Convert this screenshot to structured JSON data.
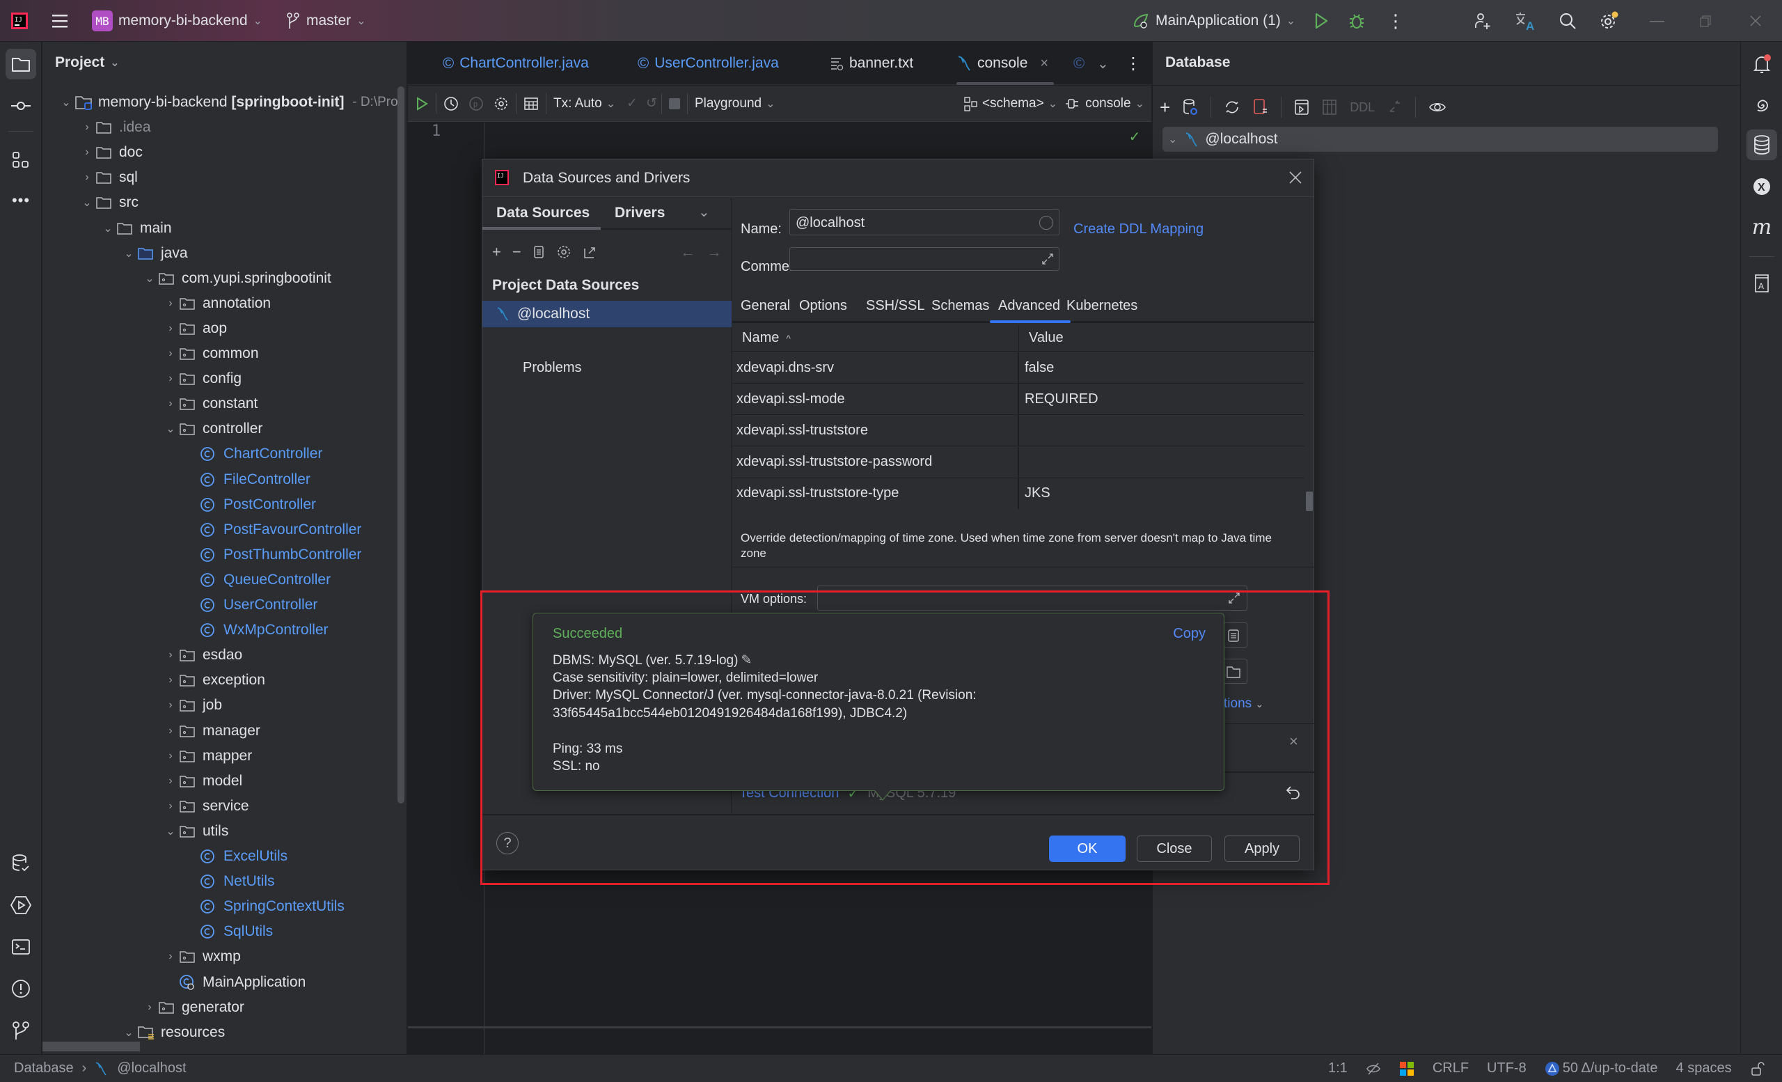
{
  "titlebar": {
    "project_badge": "MB",
    "project_name": "memory-bi-backend",
    "branch": "master",
    "run_config": "MainApplication (1)"
  },
  "project_panel": {
    "title": "Project",
    "root": {
      "name": "memory-bi-backend",
      "module": "[springboot-init]",
      "path": "- D:\\Pro"
    },
    "items": [
      {
        "label": ".idea",
        "type": "folder",
        "dim": true
      },
      {
        "label": "doc",
        "type": "folder"
      },
      {
        "label": "sql",
        "type": "folder"
      },
      {
        "label": "src",
        "type": "folder"
      },
      {
        "label": "main",
        "type": "folder"
      },
      {
        "label": "java",
        "type": "source-folder"
      },
      {
        "label": "com.yupi.springbootinit",
        "type": "package"
      },
      {
        "label": "annotation",
        "type": "package"
      },
      {
        "label": "aop",
        "type": "package"
      },
      {
        "label": "common",
        "type": "package"
      },
      {
        "label": "config",
        "type": "package"
      },
      {
        "label": "constant",
        "type": "package"
      },
      {
        "label": "controller",
        "type": "package"
      },
      {
        "label": "ChartController",
        "type": "class"
      },
      {
        "label": "FileController",
        "type": "class"
      },
      {
        "label": "PostController",
        "type": "class"
      },
      {
        "label": "PostFavourController",
        "type": "class"
      },
      {
        "label": "PostThumbController",
        "type": "class"
      },
      {
        "label": "QueueController",
        "type": "class"
      },
      {
        "label": "UserController",
        "type": "class"
      },
      {
        "label": "WxMpController",
        "type": "class"
      },
      {
        "label": "esdao",
        "type": "package"
      },
      {
        "label": "exception",
        "type": "package"
      },
      {
        "label": "job",
        "type": "package"
      },
      {
        "label": "manager",
        "type": "package"
      },
      {
        "label": "mapper",
        "type": "package"
      },
      {
        "label": "model",
        "type": "package"
      },
      {
        "label": "service",
        "type": "package"
      },
      {
        "label": "utils",
        "type": "package"
      },
      {
        "label": "ExcelUtils",
        "type": "class"
      },
      {
        "label": "NetUtils",
        "type": "class"
      },
      {
        "label": "SpringContextUtils",
        "type": "class"
      },
      {
        "label": "SqlUtils",
        "type": "class"
      },
      {
        "label": "wxmp",
        "type": "package"
      },
      {
        "label": "MainApplication",
        "type": "main-class"
      },
      {
        "label": "generator",
        "type": "package"
      },
      {
        "label": "resources",
        "type": "resources-folder"
      }
    ]
  },
  "editor": {
    "tabs": [
      {
        "label": "ChartController.java",
        "icon": "class-icon"
      },
      {
        "label": "UserController.java",
        "icon": "class-icon"
      },
      {
        "label": "banner.txt",
        "icon": "text-file-icon"
      },
      {
        "label": "console",
        "icon": "mysql-icon",
        "active": true
      }
    ],
    "toolbar": {
      "tx_mode": "Tx: Auto",
      "playground": "Playground",
      "schema": "<schema>",
      "session": "console"
    },
    "line_number": "1"
  },
  "database_panel": {
    "title": "Database",
    "toolbar_ddl": "DDL",
    "tree_item": "@localhost"
  },
  "dialog": {
    "title": "Data Sources and Drivers",
    "left_tabs": [
      "Data Sources",
      "Drivers"
    ],
    "section_title": "Project Data Sources",
    "selected_source": "@localhost",
    "problems_label": "Problems",
    "name_label": "Name:",
    "name_value": "@localhost",
    "comment_label": "Comment:",
    "comment_value": "",
    "create_ddl_link": "Create DDL Mapping",
    "tabs": [
      "General",
      "Options",
      "SSH/SSL",
      "Schemas",
      "Advanced",
      "Kubernetes"
    ],
    "active_tab": "Advanced",
    "grid": {
      "headers": [
        "Name",
        "Value"
      ],
      "sort": "ascending",
      "rows": [
        {
          "name": "xdevapi.dns-srv",
          "value": "false"
        },
        {
          "name": "xdevapi.ssl-mode",
          "value": "REQUIRED"
        },
        {
          "name": "xdevapi.ssl-truststore",
          "value": ""
        },
        {
          "name": "xdevapi.ssl-truststore-password",
          "value": ""
        },
        {
          "name": "xdevapi.ssl-truststore-type",
          "value": "JKS"
        }
      ]
    },
    "description": "Override detection/mapping of time zone. Used when time zone from server doesn't map to Java time zone",
    "vm_options_label": "VM options:",
    "more_options_link": "rt options",
    "test_connection": "Test Connection",
    "test_result": "MySQL 5.7.19",
    "buttons": {
      "ok": "OK",
      "close": "Close",
      "apply": "Apply"
    }
  },
  "popup": {
    "status": "Succeeded",
    "copy": "Copy",
    "lines": [
      "DBMS: MySQL (ver. 5.7.19-log)",
      "Case sensitivity: plain=lower, delimited=lower",
      "Driver: MySQL Connector/J (ver. mysql-connector-java-8.0.21 (Revision:",
      "33f65445a1bcc544eb0120491926484da168f199), JDBC4.2)",
      "",
      "Ping: 33 ms",
      "SSL: no"
    ]
  },
  "statusbar": {
    "breadcrumb": [
      "Database",
      "@localhost"
    ],
    "position": "1:1",
    "line_ending": "CRLF",
    "encoding": "UTF-8",
    "vcs": "50 Δ/up-to-date",
    "indent": "4 spaces"
  },
  "colors": {
    "accent": "#3574f0",
    "link": "#548af7",
    "success": "#5fb05a",
    "highlight_box": "#e3202a",
    "class_text": "#5a9cf8"
  }
}
